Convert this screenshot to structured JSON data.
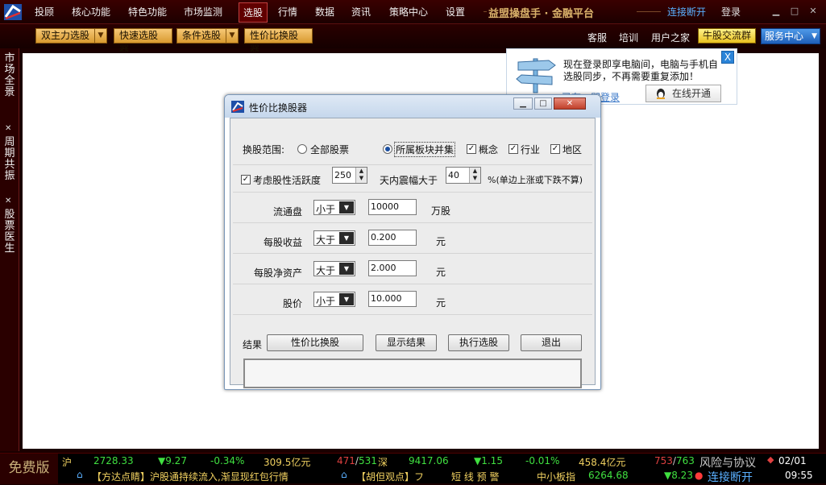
{
  "menu": {
    "items": [
      "投顾",
      "核心功能",
      "特色功能",
      "市场监测",
      "选股",
      "行情",
      "数据",
      "资讯",
      "策略中心",
      "设置"
    ],
    "brand": "益盟操盘手 · 金融平台",
    "connection_status": "连接断开",
    "login": "登录",
    "minimize": "▁",
    "maximize": "□",
    "close": "✕"
  },
  "toolbar": {
    "main_select": "双主力选股",
    "quick_select": "快速选股器",
    "condition_select": "条件选股",
    "price_ratio_select": "性价比换股器",
    "service": "客服",
    "training": "培训",
    "user_home": "用户之家",
    "qun": "牛股交流群",
    "service_center": "服务中心",
    "dropdown_arrow": "▼"
  },
  "leftbar": {
    "tab1": "市场全景",
    "tab2": "周期共振",
    "tab3": "股票医生",
    "close": "✕"
  },
  "notify": {
    "text": "现在登录即享电脑间，电脑与手机自选股同步，不再需要重复添加！",
    "link": "已有，即登录",
    "online": "在线开通",
    "close": "X"
  },
  "dialog": {
    "title": "性价比换股器",
    "scope_label": "换股范围:",
    "all_stocks": "全部股票",
    "sector_union": "所属板块并集",
    "concept": "概念",
    "industry": "行业",
    "region": "地区",
    "check_mark": "✓",
    "consider_activity": "考虑股性活跃度",
    "activity_days": "250",
    "amplitude_label": "天内震幅大于",
    "amplitude_value": "40",
    "amplitude_note": "%(单边上涨或下跌不算)",
    "rows": [
      {
        "label": "流通盘",
        "op": "小于",
        "value": "10000",
        "unit": "万股"
      },
      {
        "label": "每股收益",
        "op": "大于",
        "value": "0.200",
        "unit": "元"
      },
      {
        "label": "每股净资产",
        "op": "大于",
        "value": "2.000",
        "unit": "元"
      },
      {
        "label": "股价",
        "op": "小于",
        "value": "10.000",
        "unit": "元"
      }
    ],
    "result_label": "结果",
    "btn_ratio": "性价比换股",
    "btn_show": "显示结果",
    "btn_exec": "执行选股",
    "btn_exit": "退出"
  },
  "status": {
    "free_version": "免费版",
    "sh_label": "沪",
    "sh_index": "2728.33",
    "sh_change": "▼9.27",
    "sh_pct": "-0.34%",
    "sh_amount": "309.5亿元",
    "sh_up": "471",
    "sh_total": "531",
    "sz_label": "深",
    "sz_index": "9417.06",
    "sz_change": "▼1.15",
    "sz_pct": "-0.01%",
    "sz_amount": "458.4亿元",
    "sz_up": "753",
    "sz_total": "763",
    "risk": "风险与协议",
    "date": "02/01",
    "news1": "【方达点睛】沪股通持续流入,渐显现红包行情",
    "news2": "【胡但观点】フ",
    "alert": "短 线 预 警",
    "smb_label": "中小板指",
    "smb_index": "6264.68",
    "smb_change": "▼8.23",
    "conn": "连接断开",
    "time": "09:55",
    "slash": "/"
  }
}
